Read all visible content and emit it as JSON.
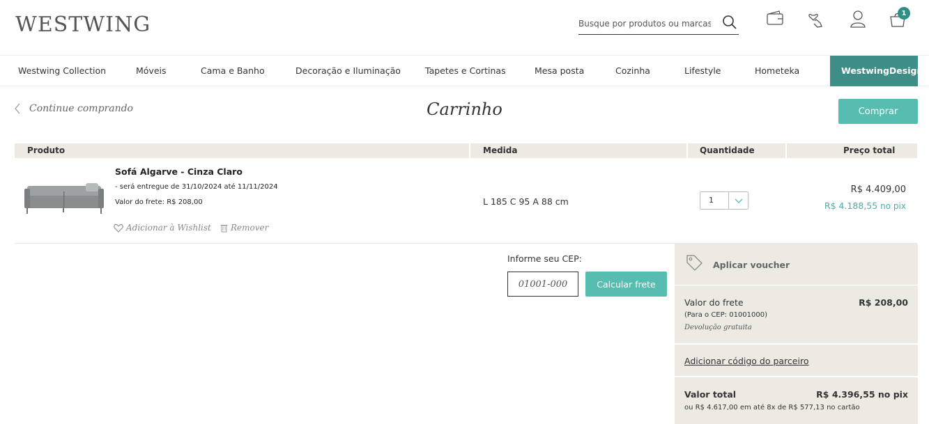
{
  "header": {
    "logo": "WESTWING",
    "search_placeholder": "Busque por produtos ou marcas",
    "cart_count": "1"
  },
  "nav": [
    {
      "label": "Westwing Collection"
    },
    {
      "label": "Móveis"
    },
    {
      "label": "Cama e Banho"
    },
    {
      "label": "Decoração e Iluminação"
    },
    {
      "label": "Tapetes e Cortinas"
    },
    {
      "label": "Mesa posta"
    },
    {
      "label": "Cozinha"
    },
    {
      "label": "Lifestyle"
    },
    {
      "label": "Hometeka"
    },
    {
      "label": "WestwingDesign"
    }
  ],
  "cart": {
    "back_label": "Continue comprando",
    "title": "Carrinho",
    "buy_label": "Comprar"
  },
  "table": {
    "headers": {
      "produto": "Produto",
      "medida": "Medida",
      "quantidade": "Quantidade",
      "preco": "Preço total"
    },
    "item": {
      "name": "Sofá Algarve - Cinza Claro",
      "delivery": "- será entregue de 31/10/2024 até 11/11/2024",
      "frete": "Valor do frete: R$ 208,00",
      "wishlist": "Adicionar à Wishlist",
      "remove": "Remover",
      "medida": "L 185 C 95 A 88 cm",
      "quantity": "1",
      "price": "R$ 4.409,00",
      "price_pix": "R$ 4.188,55",
      "pix_suffix": "no pix"
    }
  },
  "cep": {
    "label": "Informe seu CEP:",
    "placeholder": "01001-000",
    "button": "Calcular frete"
  },
  "summary": {
    "voucher": "Aplicar voucher",
    "frete_label": "Valor do frete",
    "frete_value": "R$ 208,00",
    "frete_cep": "(Para o CEP: 01001000)",
    "devolucao": "Devolução gratuita",
    "partner": "Adicionar código do parceiro",
    "total_label": "Valor total",
    "total_value": "R$ 4.396,55 no pix",
    "total_sub": "ou R$ 4.617,00 em até 8x de R$ 577,13 no cartão"
  },
  "colors": {
    "accent": "#56bdb0",
    "accent_dark": "#3e8d86",
    "panel_bg": "#eceae3",
    "pix_text": "#4bb0a4"
  }
}
